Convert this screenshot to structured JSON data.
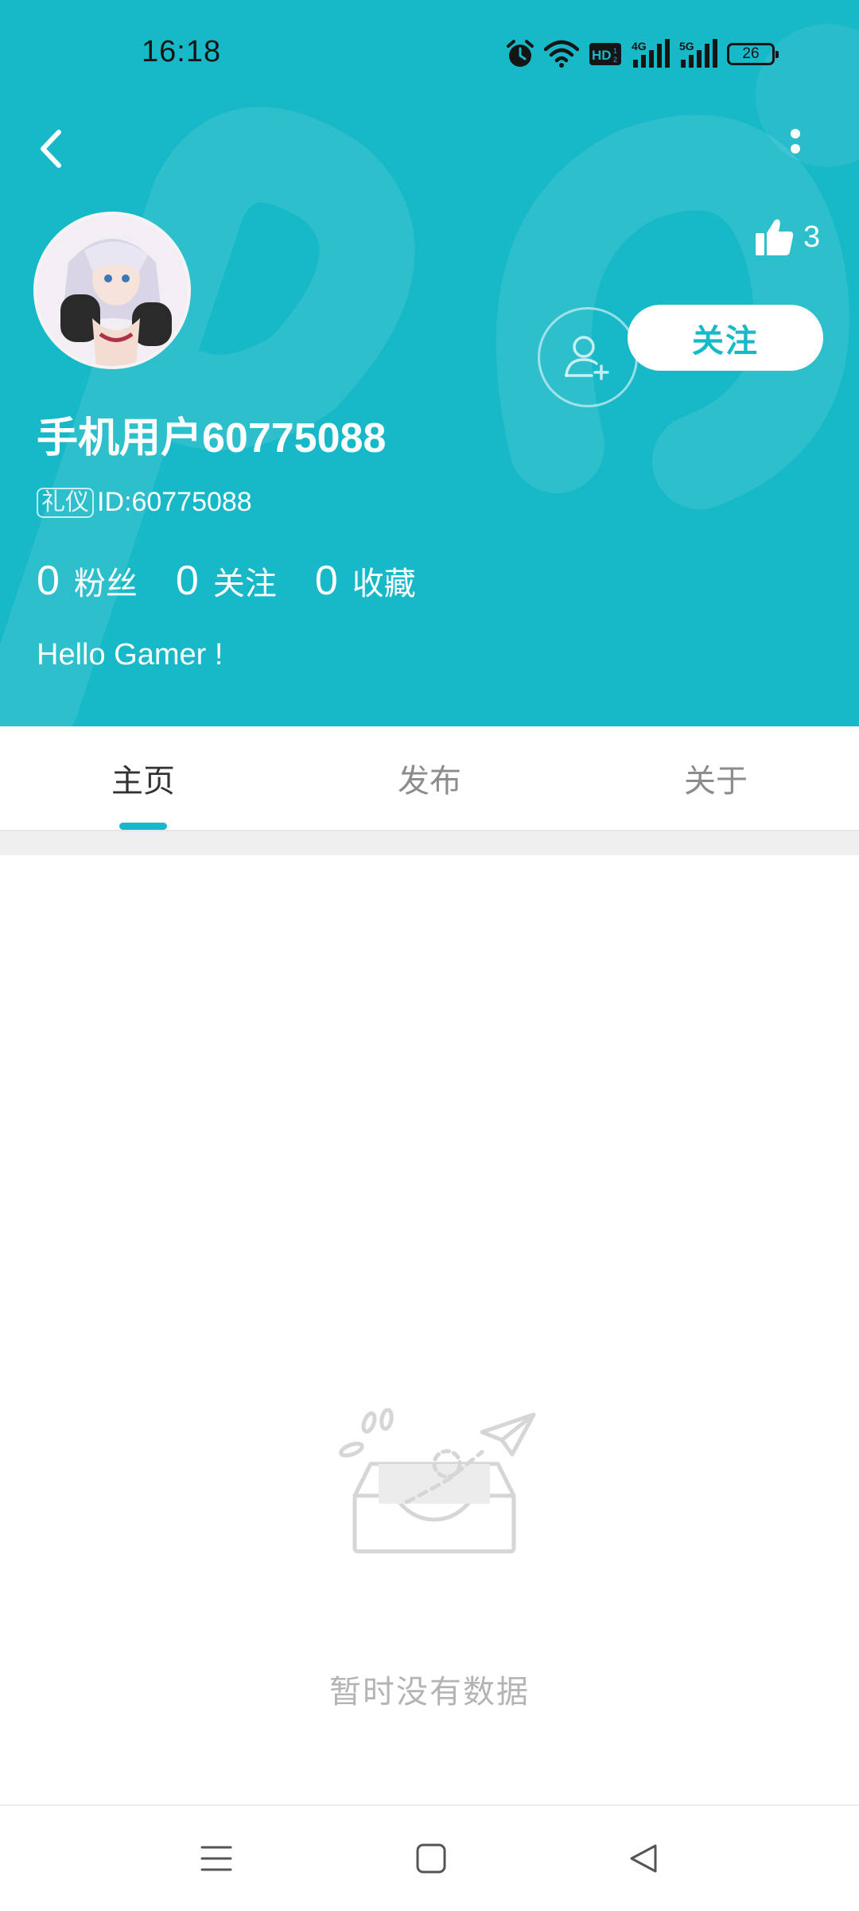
{
  "status_bar": {
    "time": "16:18",
    "battery": "26",
    "icons": [
      "alarm-icon",
      "wifi-icon",
      "hd-icon",
      "4g-signal-icon",
      "5g-signal-icon",
      "battery-icon"
    ]
  },
  "colors": {
    "accent": "#17b8c8",
    "text_light": "#ffffff",
    "tab_inactive": "#8c8c8c",
    "tab_active": "#333333",
    "empty_text": "#b4b4b4"
  },
  "header": {
    "back_icon": "chevron-left-icon",
    "more_icon": "more-vertical-icon"
  },
  "profile": {
    "likes": "3",
    "like_icon": "thumbs-up-icon",
    "add_friend_icon": "add-user-icon",
    "follow_label": "关注",
    "username": "手机用户60775088",
    "badge": "礼仪",
    "id_text": "ID:60775088",
    "stats": [
      {
        "value": "0",
        "label": "粉丝"
      },
      {
        "value": "0",
        "label": "关注"
      },
      {
        "value": "0",
        "label": "收藏"
      }
    ],
    "bio": "Hello Gamer !"
  },
  "tabs": [
    {
      "label": "主页",
      "active": true
    },
    {
      "label": "发布",
      "active": false
    },
    {
      "label": "关于",
      "active": false
    }
  ],
  "empty_state": {
    "icon": "empty-inbox-icon",
    "text": "暂时没有数据"
  },
  "nav_bar": {
    "icons": [
      "menu-icon",
      "home-icon",
      "back-triangle-icon"
    ]
  }
}
